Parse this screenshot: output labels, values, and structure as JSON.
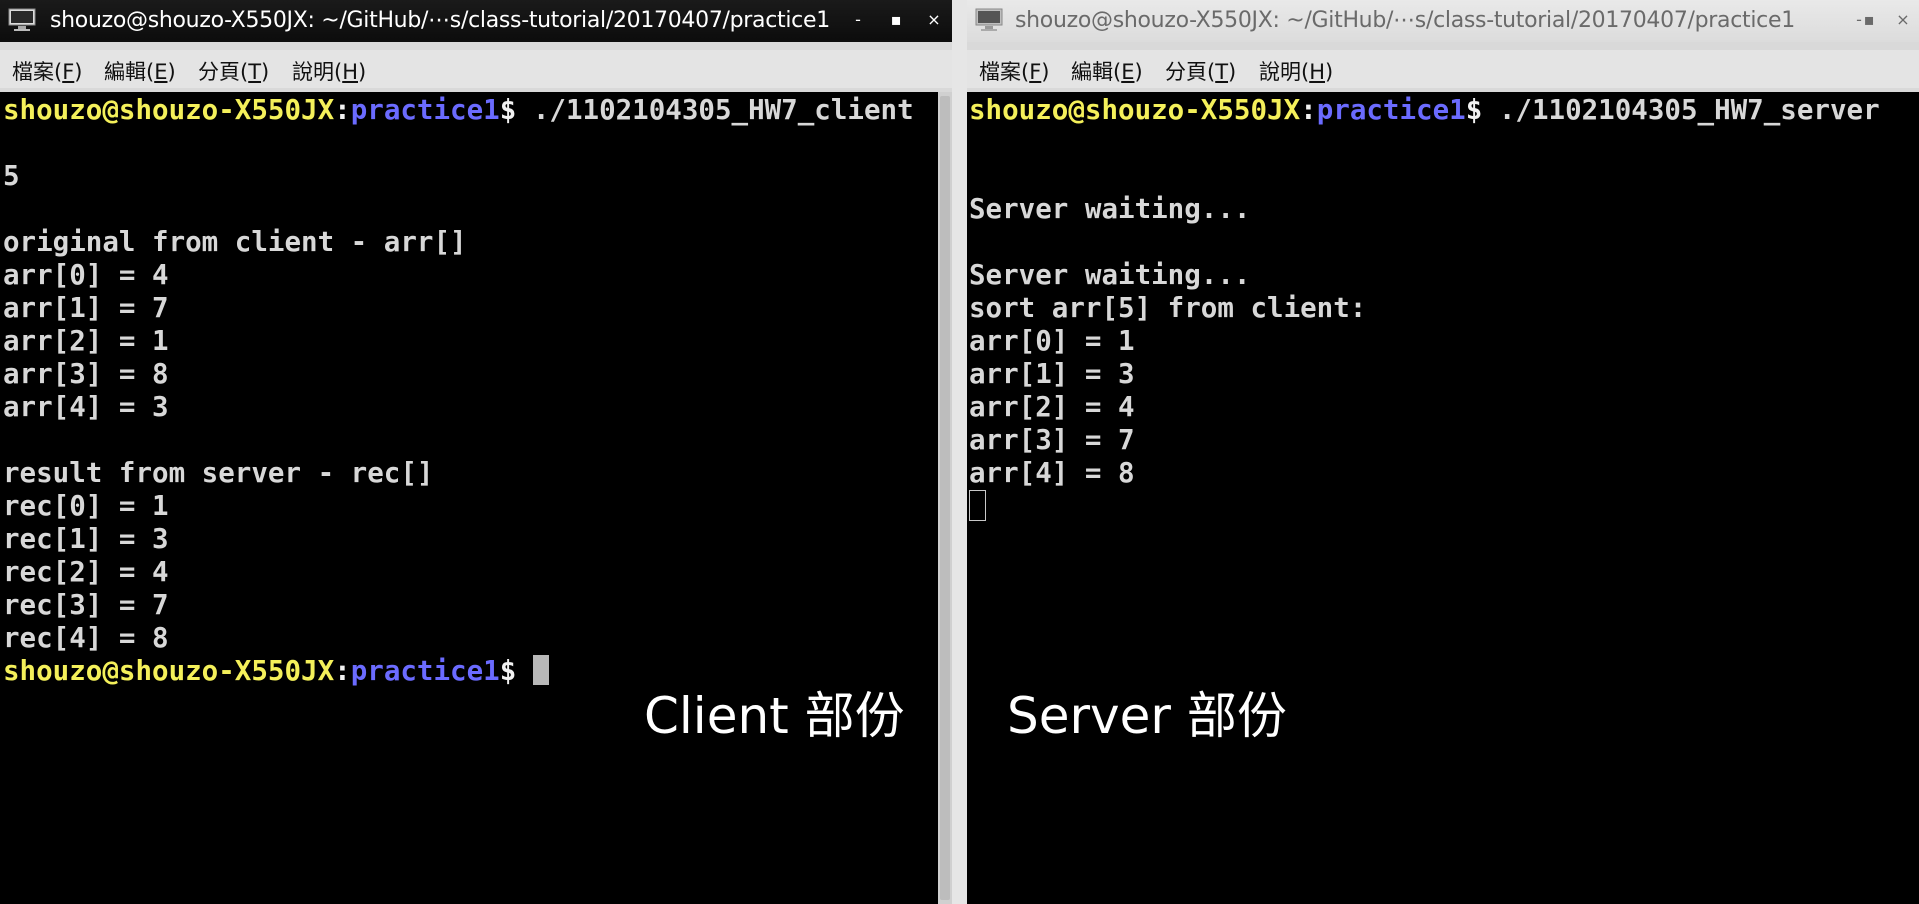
{
  "left_window": {
    "title": "shouzo@shouzo-X550JX: ~/GitHub/⋯s/class-tutorial/20170407/practice1",
    "buttons": {
      "minimize": "-",
      "maximize": "▪",
      "close": "×"
    },
    "menu": [
      {
        "label": "檔案(",
        "key": "F",
        "end": ")"
      },
      {
        "label": "編輯(",
        "key": "E",
        "end": ")"
      },
      {
        "label": "分頁(",
        "key": "T",
        "end": ")"
      },
      {
        "label": "說明(",
        "key": "H",
        "end": ")"
      }
    ],
    "prompt_user": "shouzo@shouzo-X550JX",
    "prompt_colon": ":",
    "prompt_path": "practice1",
    "prompt_dollar": "$",
    "command": " ./1102104305_HW7_client",
    "lines": [
      "",
      "5",
      "",
      "original from client - arr[]",
      "arr[0] = 4",
      "arr[1] = 7",
      "arr[2] = 1",
      "arr[3] = 8",
      "arr[4] = 3",
      "",
      "result from server - rec[]",
      "rec[0] = 1",
      "rec[1] = 3",
      "rec[2] = 4",
      "rec[3] = 7",
      "rec[4] = 8"
    ],
    "caption": "Client 部份"
  },
  "right_window": {
    "title": "shouzo@shouzo-X550JX: ~/GitHub/⋯s/class-tutorial/20170407/practice1",
    "buttons": {
      "minimize": "-",
      "maximize": "▪",
      "close": "×"
    },
    "menu": [
      {
        "label": "檔案(",
        "key": "F",
        "end": ")"
      },
      {
        "label": "編輯(",
        "key": "E",
        "end": ")"
      },
      {
        "label": "分頁(",
        "key": "T",
        "end": ")"
      },
      {
        "label": "說明(",
        "key": "H",
        "end": ")"
      }
    ],
    "prompt_user": "shouzo@shouzo-X550JX",
    "prompt_colon": ":",
    "prompt_path": "practice1",
    "prompt_dollar": "$",
    "command": " ./1102104305_HW7_server",
    "lines": [
      "",
      "",
      "Server waiting...",
      "",
      "Server waiting...",
      "sort arr[5] from client:",
      "arr[0] = 1",
      "arr[1] = 3",
      "arr[2] = 4",
      "arr[3] = 7",
      "arr[4] = 8"
    ],
    "caption": "Server 部份"
  },
  "colors": {
    "terminal_bg": "#000000",
    "terminal_fg": "#d8d8d8",
    "prompt_user": "#f4f05a",
    "prompt_path": "#6b6bff"
  }
}
